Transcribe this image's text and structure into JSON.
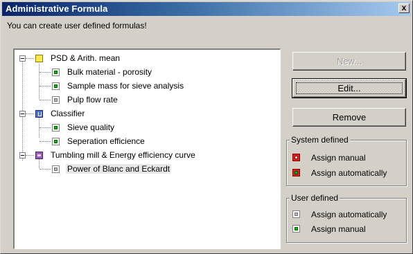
{
  "window": {
    "title": "Administrative Formula",
    "close_label": "x",
    "subtitle": "You can create user defined formulas!"
  },
  "tree": {
    "groups": [
      {
        "label": "PSD & Arith. mean",
        "icon": "yellow-folder-icon",
        "items": [
          {
            "label": "Bulk material - porosity",
            "status": "green"
          },
          {
            "label": "Sample mass for sieve analysis",
            "status": "green"
          },
          {
            "label": "Pulp flow rate",
            "status": "gray"
          }
        ]
      },
      {
        "label": "Classifier",
        "icon": "classifier-icon",
        "items": [
          {
            "label": "Sieve quality",
            "status": "green"
          },
          {
            "label": "Seperation efficience",
            "status": "green"
          }
        ]
      },
      {
        "label": "Tumbling mill & Energy efficiency curve",
        "icon": "mill-icon",
        "items": [
          {
            "label": "Power of Blanc and Eckardt",
            "status": "gray",
            "selected": true
          }
        ]
      }
    ]
  },
  "buttons": {
    "new_label": "New...",
    "edit_label": "Edit...",
    "remove_label": "Remove"
  },
  "legend": {
    "system_defined": {
      "title": "System defined",
      "items": [
        {
          "label": "Assign manual",
          "icon": "red-indicator-icon"
        },
        {
          "label": "Assign automatically",
          "icon": "red-green-indicator-icon"
        }
      ]
    },
    "user_defined": {
      "title": "User defined",
      "items": [
        {
          "label": "Assign automatically",
          "icon": "gray-indicator-icon"
        },
        {
          "label": "Assign manual",
          "icon": "green-indicator-icon"
        }
      ]
    }
  },
  "colors": {
    "titlebar_start": "#0a246a",
    "titlebar_end": "#a6caf0",
    "dialog_bg": "#d4d0c8",
    "status_green": "#00c000",
    "status_red": "#e02020"
  }
}
